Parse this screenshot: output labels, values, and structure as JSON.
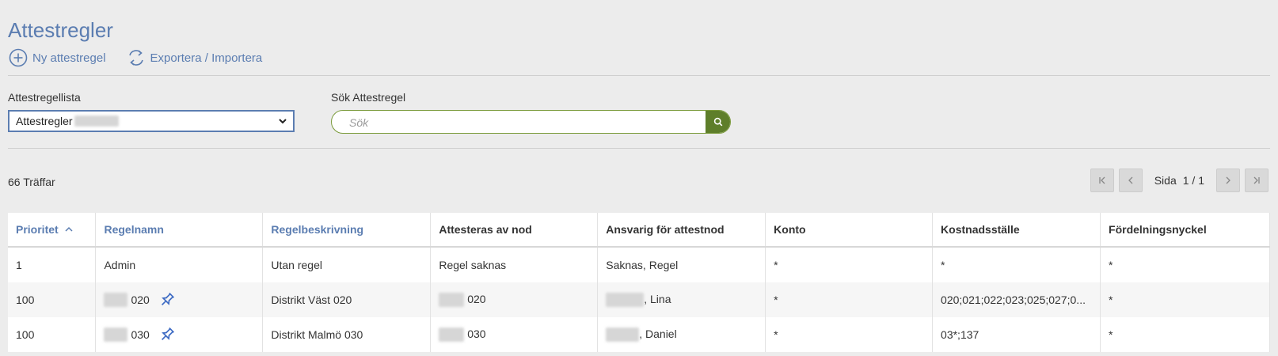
{
  "page": {
    "title": "Attestregler"
  },
  "toolbar": {
    "new_rule": "Ny attestregel",
    "export_import": "Exportera / Importera"
  },
  "filters": {
    "list_label": "Attestregellista",
    "list_value": "Attestregler",
    "search_label": "Sök Attestregel",
    "search_placeholder": "Sök"
  },
  "results": {
    "count": "66 Träffar"
  },
  "pager": {
    "label": "Sida",
    "value": "1 / 1"
  },
  "table": {
    "headers": {
      "priority": "Prioritet",
      "name": "Regelnamn",
      "desc": "Regelbeskrivning",
      "node": "Attesteras av nod",
      "owner": "Ansvarig för attestnod",
      "account": "Konto",
      "cost": "Kostnadsställe",
      "key": "Fördelningsnyckel"
    },
    "rows": [
      {
        "priority": "1",
        "name": "Admin",
        "desc": "Utan regel",
        "node": "Regel saknas",
        "owner": "Saknas, Regel",
        "account": "*",
        "cost": "*",
        "key": "*"
      },
      {
        "priority": "100",
        "name": "020",
        "desc": "Distrikt Väst 020",
        "node": "020",
        "owner": ", Lina",
        "account": "*",
        "cost": "020;021;022;023;025;027;0...",
        "key": "*"
      },
      {
        "priority": "100",
        "name": "030",
        "desc": "Distrikt Malmö 030",
        "node": "030",
        "owner": ", Daniel",
        "account": "*",
        "cost": "03*;137",
        "key": "*"
      }
    ]
  },
  "colors": {
    "accent": "#5b7db1",
    "search_button": "#5e7e2a"
  }
}
